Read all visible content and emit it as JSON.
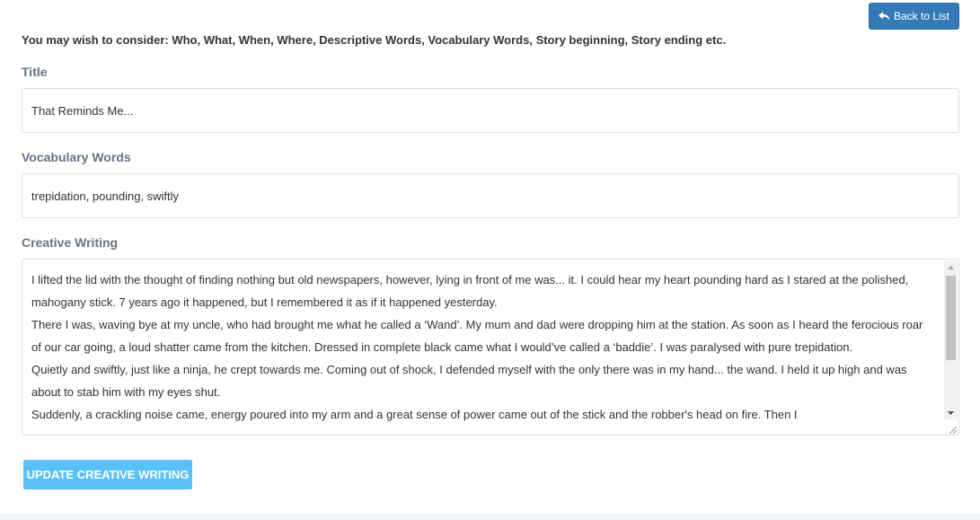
{
  "header": {
    "back_button_label": "Back to List",
    "back_icon": "reply-icon"
  },
  "hint": "You may wish to consider: Who, What, When, Where, Descriptive Words, Vocabulary Words, Story beginning, Story ending etc.",
  "title_field": {
    "label": "Title",
    "value": "That Reminds Me..."
  },
  "vocabulary_field": {
    "label": "Vocabulary Words",
    "value": "trepidation, pounding, swiftly"
  },
  "creative_writing": {
    "label": "Creative Writing",
    "paragraphs": [
      "I lifted the lid with the thought of finding nothing but old newspapers, however, lying in front of me was... it. I could hear my heart pounding hard as I stared at the polished, mahogany stick. 7 years ago it happened, but I remembered it as if it happened yesterday.",
      "There I was, waving bye at my uncle, who had brought me what he called a ‘Wand’. My mum and dad were dropping him at the station. As soon as I heard the ferocious roar of our car going, a loud shatter came from the kitchen. Dressed in complete black came what I would’ve called a ‘baddie’. I was paralysed with pure trepidation.",
      "Quietly and swiftly, just like a ninja, he crept towards me. Coming out of shock, I defended myself with the only there was in my hand... the wand. I held it up high and was about to stab him with my eyes shut.",
      "Suddenly, a crackling noise came, energy poured into my arm and a great sense of power came out of the stick and the robber's head on fire. Then I"
    ]
  },
  "actions": {
    "update_label": "UPDATE CREATIVE WRITING"
  },
  "colors": {
    "primary": "#337ab7",
    "update_button": "#5bc0f8",
    "label_text": "#687385"
  }
}
